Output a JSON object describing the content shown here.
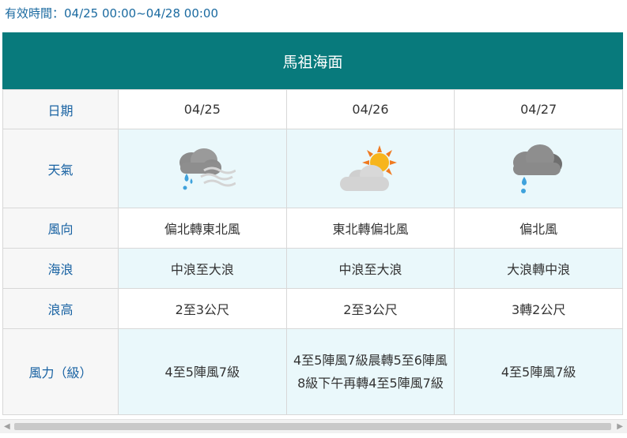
{
  "validity": "有效時間：04/25 00:00~04/28 00:00",
  "title": "馬祖海面",
  "rows": {
    "date": {
      "label": "日期",
      "values": [
        "04/25",
        "04/26",
        "04/27"
      ]
    },
    "weather": {
      "label": "天氣",
      "icons": [
        "cloud-rain-fog-icon",
        "sun-cloud-icon",
        "cloud-rain-icon"
      ]
    },
    "wind_dir": {
      "label": "風向",
      "values": [
        "偏北轉東北風",
        "東北轉偏北風",
        "偏北風"
      ]
    },
    "wave": {
      "label": "海浪",
      "values": [
        "中浪至大浪",
        "中浪至大浪",
        "大浪轉中浪"
      ]
    },
    "wave_height": {
      "label": "浪高",
      "values": [
        "2至3公尺",
        "2至3公尺",
        "3轉2公尺"
      ]
    },
    "wind_force": {
      "label": "風力（級）",
      "values": [
        "4至5陣風7級",
        "4至5陣風7級晨轉5至6陣風8級下午再轉4至5陣風7級",
        "4至5陣風7級"
      ]
    }
  },
  "colors": {
    "header": "#087a7c",
    "label_text": "#1a63a3",
    "cyan_row": "#eaf8fb"
  }
}
